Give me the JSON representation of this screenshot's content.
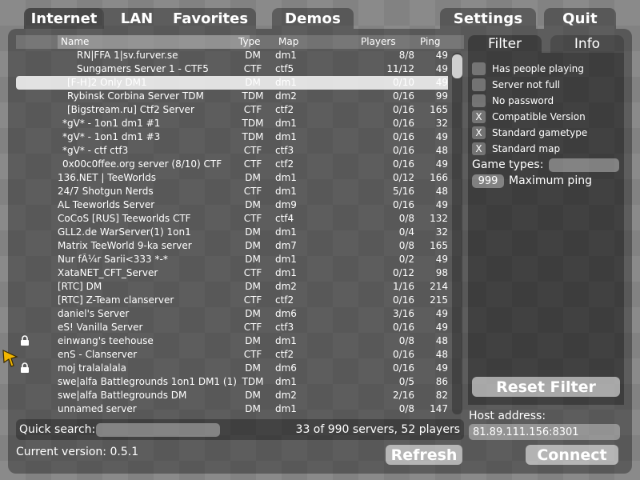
{
  "tabs": {
    "internet": "Internet",
    "lan": "LAN",
    "favorites": "Favorites",
    "demos": "Demos",
    "settings": "Settings",
    "quit": "Quit"
  },
  "list": {
    "columns": [
      "Name",
      "Type",
      "Map",
      "Players",
      "Ping"
    ],
    "rows": [
      {
        "name": "RN|FFA 1|sv.furver.se",
        "type": "DM",
        "map": "dm1",
        "players": "8/8",
        "ping": "49",
        "indent": 2,
        "selected": false,
        "locked": false
      },
      {
        "name": "Sungamers Server 1 - CTF5",
        "type": "CTF",
        "map": "ctf5",
        "players": "11/12",
        "ping": "49",
        "indent": 2,
        "selected": false,
        "locked": false
      },
      {
        "name": "[F-H]2 Only DM1",
        "type": "DM",
        "map": "dm1",
        "players": "0/10",
        "ping": "49",
        "indent": 1,
        "selected": true,
        "locked": false
      },
      {
        "name": "Rybinsk Corbina Server TDM",
        "type": "TDM",
        "map": "dm2",
        "players": "0/16",
        "ping": "99",
        "indent": 1,
        "selected": false,
        "locked": false
      },
      {
        "name": "[Bigstream.ru] Ctf2 Server",
        "type": "CTF",
        "map": "ctf2",
        "players": "0/16",
        "ping": "165",
        "indent": 1,
        "selected": false,
        "locked": false
      },
      {
        "name": "*gV* - 1on1 dm1 #1",
        "type": "TDM",
        "map": "dm1",
        "players": "0/16",
        "ping": "32",
        "indent": 0.5,
        "selected": false,
        "locked": false
      },
      {
        "name": "*gV* - 1on1 dm1 #3",
        "type": "TDM",
        "map": "dm1",
        "players": "0/16",
        "ping": "49",
        "indent": 0.5,
        "selected": false,
        "locked": false
      },
      {
        "name": "*gV* - ctf ctf3",
        "type": "CTF",
        "map": "ctf3",
        "players": "0/16",
        "ping": "48",
        "indent": 0.5,
        "selected": false,
        "locked": false
      },
      {
        "name": "0x00c0ffee.org server (8/10) CTF",
        "type": "CTF",
        "map": "ctf2",
        "players": "0/16",
        "ping": "49",
        "indent": 0.5,
        "selected": false,
        "locked": false
      },
      {
        "name": "136.NET | TeeWorlds",
        "type": "DM",
        "map": "dm1",
        "players": "0/12",
        "ping": "166",
        "indent": 0,
        "selected": false,
        "locked": false
      },
      {
        "name": "24/7 Shotgun Nerds",
        "type": "CTF",
        "map": "dm1",
        "players": "5/16",
        "ping": "48",
        "indent": 0,
        "selected": false,
        "locked": false
      },
      {
        "name": "AL Teeworlds Server",
        "type": "DM",
        "map": "dm9",
        "players": "0/16",
        "ping": "49",
        "indent": 0,
        "selected": false,
        "locked": false
      },
      {
        "name": "CoCoS [RUS] Teeworlds CTF",
        "type": "CTF",
        "map": "ctf4",
        "players": "0/8",
        "ping": "132",
        "indent": 0,
        "selected": false,
        "locked": false
      },
      {
        "name": "GLL2.de WarServer(1) 1on1",
        "type": "DM",
        "map": "dm1",
        "players": "0/4",
        "ping": "32",
        "indent": 0,
        "selected": false,
        "locked": false
      },
      {
        "name": "Matrix TeeWorld 9-ka server",
        "type": "DM",
        "map": "dm7",
        "players": "0/8",
        "ping": "165",
        "indent": 0,
        "selected": false,
        "locked": false
      },
      {
        "name": "Nur fÃ¼r Sarii<333 *-*",
        "type": "DM",
        "map": "dm1",
        "players": "0/2",
        "ping": "49",
        "indent": 0,
        "selected": false,
        "locked": false
      },
      {
        "name": "XataNET_CFT_Server",
        "type": "CTF",
        "map": "dm1",
        "players": "0/12",
        "ping": "98",
        "indent": 0,
        "selected": false,
        "locked": false
      },
      {
        "name": "[RTC] DM",
        "type": "DM",
        "map": "dm2",
        "players": "1/16",
        "ping": "214",
        "indent": 0,
        "selected": false,
        "locked": false
      },
      {
        "name": "[RTC] Z-Team clanserver",
        "type": "CTF",
        "map": "ctf2",
        "players": "0/16",
        "ping": "215",
        "indent": 0,
        "selected": false,
        "locked": false
      },
      {
        "name": "daniel's Server",
        "type": "DM",
        "map": "dm6",
        "players": "3/16",
        "ping": "49",
        "indent": 0,
        "selected": false,
        "locked": false
      },
      {
        "name": "eS! Vanilla Server",
        "type": "CTF",
        "map": "ctf3",
        "players": "0/16",
        "ping": "49",
        "indent": 0,
        "selected": false,
        "locked": false
      },
      {
        "name": "einwang's teehouse",
        "type": "DM",
        "map": "dm1",
        "players": "0/8",
        "ping": "48",
        "indent": 0,
        "selected": false,
        "locked": true
      },
      {
        "name": "enS - Clanserver",
        "type": "CTF",
        "map": "ctf2",
        "players": "0/16",
        "ping": "48",
        "indent": 0,
        "selected": false,
        "locked": false
      },
      {
        "name": "moj tralalalala",
        "type": "DM",
        "map": "dm6",
        "players": "0/16",
        "ping": "49",
        "indent": 0,
        "selected": false,
        "locked": true
      },
      {
        "name": "swe|alfa Battlegrounds 1on1 DM1 (1)",
        "type": "TDM",
        "map": "dm1",
        "players": "0/5",
        "ping": "86",
        "indent": 0,
        "selected": false,
        "locked": false
      },
      {
        "name": "swe|alfa Battlegrounds DM",
        "type": "DM",
        "map": "dm2",
        "players": "2/16",
        "ping": "82",
        "indent": 0,
        "selected": false,
        "locked": false
      },
      {
        "name": "unnamed server",
        "type": "DM",
        "map": "dm1",
        "players": "0/8",
        "ping": "147",
        "indent": 0,
        "selected": false,
        "locked": false
      }
    ]
  },
  "search": {
    "label": "Quick search:",
    "value": "",
    "summary": "33 of 990 servers, 52 players"
  },
  "version": "Current version: 0.5.1",
  "buttons": {
    "refresh": "Refresh",
    "connect": "Connect",
    "reset_filter": "Reset Filter"
  },
  "filter": {
    "tabs": [
      "Filter",
      "Info"
    ],
    "options": [
      {
        "label": "Has people playing",
        "checked": false,
        "mark": ""
      },
      {
        "label": "Server not full",
        "checked": false,
        "mark": ""
      },
      {
        "label": "No password",
        "checked": false,
        "mark": ""
      },
      {
        "label": "Compatible Version",
        "checked": true,
        "mark": "X"
      },
      {
        "label": "Standard gametype",
        "checked": true,
        "mark": "X"
      },
      {
        "label": "Standard map",
        "checked": true,
        "mark": "X"
      }
    ],
    "game_types_label": "Game types:",
    "game_types_value": "",
    "max_ping_value": "999",
    "max_ping_label": "Maximum ping"
  },
  "host": {
    "label": "Host address:",
    "value": "81.89.111.156:8301"
  },
  "icons": {
    "lock": "lock-icon",
    "cursor": "mouse-pointer-icon"
  }
}
